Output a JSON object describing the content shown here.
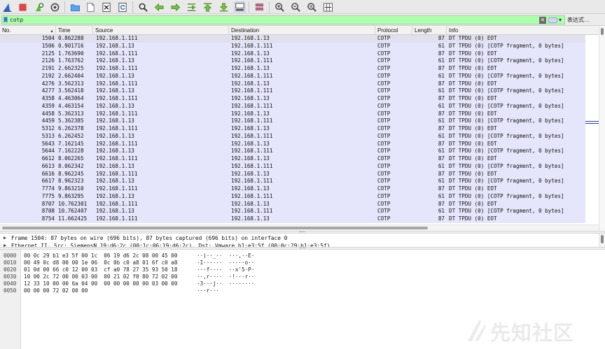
{
  "toolbar": {
    "icons": [
      "shark-fin-icon",
      "stop-capture-icon",
      "restart-capture-icon",
      "capture-options-icon",
      "open-file-icon",
      "save-file-icon",
      "close-file-icon",
      "reload-icon",
      "find-packet-icon",
      "go-back-icon",
      "go-forward-icon",
      "go-to-packet-icon",
      "go-first-icon",
      "go-last-icon",
      "autoscroll-icon",
      "colorize-icon",
      "zoom-in-icon",
      "zoom-out-icon",
      "zoom-normal-icon",
      "resize-columns-icon"
    ]
  },
  "filter": {
    "value": "cotp",
    "dropdown_glyph": "▾",
    "expression_label": "表达式…",
    "clear_glyph": "✕",
    "color": "#afffaf"
  },
  "packet_list": {
    "columns": {
      "no": "No.",
      "time": "Time",
      "source": "Source",
      "destination": "Destination",
      "protocol": "Protocol",
      "length": "Length",
      "info": "Info"
    },
    "row_color": "#e5e5fb",
    "rows": [
      {
        "no": "1504",
        "time": "0.862288",
        "src": "192.168.1.111",
        "dst": "192.168.1.13",
        "proto": "COTP",
        "len": "87",
        "info": "DT TPDU (0) EOT",
        "selected": true
      },
      {
        "no": "1506",
        "time": "0.901716",
        "src": "192.168.1.13",
        "dst": "192.168.1.111",
        "proto": "COTP",
        "len": "61",
        "info": "DT TPDU (0) [COTP fragment, 0 bytes]"
      },
      {
        "no": "2125",
        "time": "1.763690",
        "src": "192.168.1.111",
        "dst": "192.168.1.13",
        "proto": "COTP",
        "len": "87",
        "info": "DT TPDU (0) EOT"
      },
      {
        "no": "2126",
        "time": "1.763762",
        "src": "192.168.1.13",
        "dst": "192.168.1.111",
        "proto": "COTP",
        "len": "61",
        "info": "DT TPDU (0) [COTP fragment, 0 bytes]"
      },
      {
        "no": "2191",
        "time": "2.662325",
        "src": "192.168.1.111",
        "dst": "192.168.1.13",
        "proto": "COTP",
        "len": "87",
        "info": "DT TPDU (0) EOT"
      },
      {
        "no": "2192",
        "time": "2.662404",
        "src": "192.168.1.13",
        "dst": "192.168.1.111",
        "proto": "COTP",
        "len": "61",
        "info": "DT TPDU (0) [COTP fragment, 0 bytes]"
      },
      {
        "no": "4276",
        "time": "3.562313",
        "src": "192.168.1.111",
        "dst": "192.168.1.13",
        "proto": "COTP",
        "len": "87",
        "info": "DT TPDU (0) EOT"
      },
      {
        "no": "4277",
        "time": "3.562418",
        "src": "192.168.1.13",
        "dst": "192.168.1.111",
        "proto": "COTP",
        "len": "61",
        "info": "DT TPDU (0) [COTP fragment, 0 bytes]"
      },
      {
        "no": "4358",
        "time": "4.463064",
        "src": "192.168.1.111",
        "dst": "192.168.1.13",
        "proto": "COTP",
        "len": "87",
        "info": "DT TPDU (0) EOT"
      },
      {
        "no": "4359",
        "time": "4.463154",
        "src": "192.168.1.13",
        "dst": "192.168.1.111",
        "proto": "COTP",
        "len": "61",
        "info": "DT TPDU (0) [COTP fragment, 0 bytes]"
      },
      {
        "no": "4458",
        "time": "5.362313",
        "src": "192.168.1.111",
        "dst": "192.168.1.13",
        "proto": "COTP",
        "len": "87",
        "info": "DT TPDU (0) EOT"
      },
      {
        "no": "4459",
        "time": "5.362385",
        "src": "192.168.1.13",
        "dst": "192.168.1.111",
        "proto": "COTP",
        "len": "61",
        "info": "DT TPDU (0) [COTP fragment, 0 bytes]"
      },
      {
        "no": "5312",
        "time": "6.262378",
        "src": "192.168.1.111",
        "dst": "192.168.1.13",
        "proto": "COTP",
        "len": "87",
        "info": "DT TPDU (0) EOT"
      },
      {
        "no": "5313",
        "time": "6.262452",
        "src": "192.168.1.13",
        "dst": "192.168.1.111",
        "proto": "COTP",
        "len": "61",
        "info": "DT TPDU (0) [COTP fragment, 0 bytes]"
      },
      {
        "no": "5643",
        "time": "7.162145",
        "src": "192.168.1.111",
        "dst": "192.168.1.13",
        "proto": "COTP",
        "len": "87",
        "info": "DT TPDU (0) EOT"
      },
      {
        "no": "5644",
        "time": "7.162228",
        "src": "192.168.1.13",
        "dst": "192.168.1.111",
        "proto": "COTP",
        "len": "61",
        "info": "DT TPDU (0) [COTP fragment, 0 bytes]"
      },
      {
        "no": "6612",
        "time": "8.062265",
        "src": "192.168.1.111",
        "dst": "192.168.1.13",
        "proto": "COTP",
        "len": "87",
        "info": "DT TPDU (0) EOT"
      },
      {
        "no": "6613",
        "time": "8.062342",
        "src": "192.168.1.13",
        "dst": "192.168.1.111",
        "proto": "COTP",
        "len": "61",
        "info": "DT TPDU (0) [COTP fragment, 0 bytes]"
      },
      {
        "no": "6616",
        "time": "8.962245",
        "src": "192.168.1.111",
        "dst": "192.168.1.13",
        "proto": "COTP",
        "len": "87",
        "info": "DT TPDU (0) EOT"
      },
      {
        "no": "6617",
        "time": "8.962323",
        "src": "192.168.1.13",
        "dst": "192.168.1.111",
        "proto": "COTP",
        "len": "61",
        "info": "DT TPDU (0) [COTP fragment, 0 bytes]"
      },
      {
        "no": "7774",
        "time": "9.863210",
        "src": "192.168.1.111",
        "dst": "192.168.1.13",
        "proto": "COTP",
        "len": "87",
        "info": "DT TPDU (0) EOT"
      },
      {
        "no": "7775",
        "time": "9.863295",
        "src": "192.168.1.13",
        "dst": "192.168.1.111",
        "proto": "COTP",
        "len": "61",
        "info": "DT TPDU (0) [COTP fragment, 0 bytes]"
      },
      {
        "no": "8707",
        "time": "10.762301",
        "src": "192.168.1.111",
        "dst": "192.168.1.13",
        "proto": "COTP",
        "len": "87",
        "info": "DT TPDU (0) EOT"
      },
      {
        "no": "8708",
        "time": "10.762407",
        "src": "192.168.1.13",
        "dst": "192.168.1.111",
        "proto": "COTP",
        "len": "61",
        "info": "DT TPDU (0) [COTP fragment, 0 bytes]"
      },
      {
        "no": "8754",
        "time": "11.662425",
        "src": "192.168.1.111",
        "dst": "192.168.1.13",
        "proto": "COTP",
        "len": "87",
        "info": "DT TPDU (0) EOT"
      }
    ]
  },
  "details": {
    "rows": [
      {
        "text": "Frame 1504: 87 bytes on wire (696 bits), 87 bytes captured (696 bits) on interface 0"
      },
      {
        "text": "Ethernet II, Src: SiemensN_19:d6:2c (00:1c:06:19:d6:2c), Dst: Vmware_b1:e3:5f (00:0c:29:b1:e3:5f)"
      }
    ]
  },
  "bytes": {
    "rows": [
      {
        "off": "0000",
        "hex": "00 0c 29 b1 e3 5f 00 1c  06 19 d6 2c 08 00 45 00",
        "ascii": "··)··_··  ···,··E·"
      },
      {
        "off": "0010",
        "hex": "00 49 0c d8 00 00 1e 06  0c 0b c0 a8 01 6f c0 a8",
        "ascii": "·I······  ·····o··"
      },
      {
        "off": "0020",
        "hex": "01 0d 00 66 c0 12 00 03  cf a0 78 27 35 93 50 18",
        "ascii": "···f····  ··x'5·P·"
      },
      {
        "off": "0030",
        "hex": "10 00 2c 72 00 00 03 00  00 21 02 f0 80 72 02 00",
        "ascii": "··,r····  ·!···r··"
      },
      {
        "off": "0040",
        "hex": "12 33 10 00 00 6a 04 00  00 00 00 00 00 03 00 00",
        "ascii": "·3···j··  ········"
      },
      {
        "off": "0050",
        "hex": "00 00 00 72 02 00 00",
        "ascii": "···r···"
      }
    ]
  },
  "watermark": {
    "text": "先知社区"
  }
}
